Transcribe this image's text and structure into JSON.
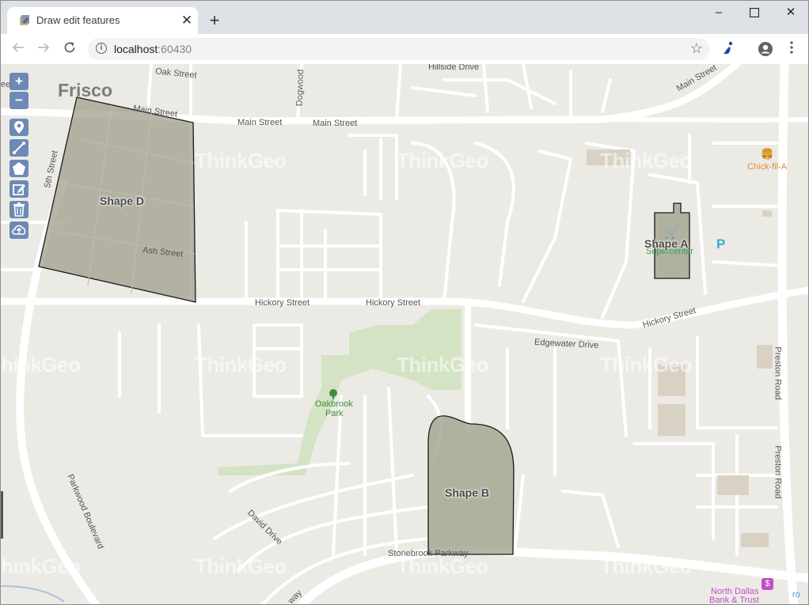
{
  "browser": {
    "tab_title": "Draw edit features",
    "url_host": "localhost",
    "url_port": ":60430",
    "window_controls": {
      "minimize": "–",
      "maximize": "☐",
      "close": "✕"
    },
    "new_tab": "+",
    "tab_close": "✕"
  },
  "map": {
    "city": "Frisco",
    "streets": {
      "oak": "Oak Street",
      "dogwood": "Dogwood",
      "hillside": "Hillside Drive",
      "main1": "Main Street",
      "main2": "Main Street",
      "main3": "Main Street",
      "main4": "Main Street",
      "fifth": "5th Street",
      "ash": "Ash Street",
      "hickory1": "Hickory Street",
      "hickory2": "Hickory Street",
      "hickory3": "Hickory Street",
      "edgewater": "Edgewater Drive",
      "preston1": "Preston Road",
      "preston2": "Preston Road",
      "parkwood": "Parkwood Boulevard",
      "david": "David Drive",
      "stonebrook": "Stonebrook Parkway",
      "way": "way",
      "street_left": "eet"
    },
    "pois": {
      "chick": "Chick-fil-A",
      "supercenter": "Supercenter",
      "park_line1": "Oakbrook",
      "park_line2": "Park",
      "bank_line1": "North Dallas",
      "bank_line2": "Bank & Trust",
      "parking": "P",
      "edge_text": "ro"
    },
    "shapes": {
      "a": "Shape A",
      "b": "Shape B",
      "d": "Shape D"
    },
    "watermark": "ThinkGeo",
    "watermark_left": "hinkGeo",
    "tools": {
      "zoom_in": "+",
      "zoom_out": "−"
    }
  }
}
